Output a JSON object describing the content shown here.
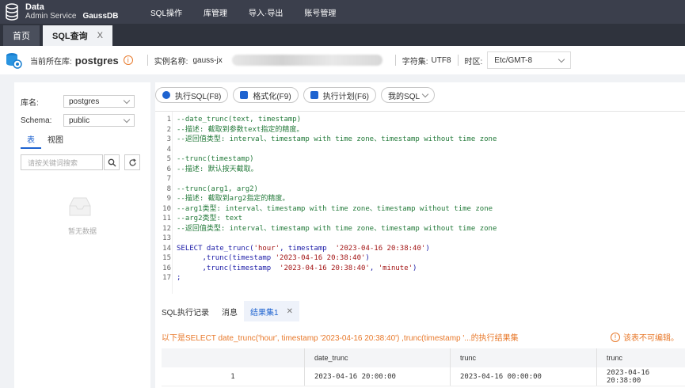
{
  "app": {
    "logo_line1": "Data",
    "logo_line2": "Admin Service",
    "product": "GaussDB",
    "nav": [
      "SQL操作",
      "库管理",
      "导入·导出",
      "账号管理"
    ]
  },
  "tabs": {
    "home": "首页",
    "active": "SQL查询",
    "close": "X"
  },
  "info": {
    "current_db_label": "当前所在库:",
    "current_db": "postgres",
    "instance_label": "实例名称:",
    "instance": "gauss-jx",
    "charset_label": "字符集:",
    "charset": "UTF8",
    "timezone_label": "时区:",
    "timezone": "Etc/GMT-8"
  },
  "left": {
    "db_label": "库名:",
    "db_value": "postgres",
    "schema_label": "Schema:",
    "schema_value": "public",
    "tab_table": "表",
    "tab_view": "视图",
    "search_placeholder": "请按关键词搜索",
    "empty_text": "暂无数据"
  },
  "toolbar": {
    "execute": "执行SQL(F8)",
    "format": "格式化(F9)",
    "plan": "执行计划(F6)",
    "my_sql": "我的SQL"
  },
  "editor": {
    "lines": [
      {
        "n": "1",
        "parts": [
          {
            "t": "--date_trunc(text, timestamp)",
            "c": "comment"
          }
        ]
      },
      {
        "n": "2",
        "parts": [
          {
            "t": "--描述: 截取到参数text指定的精度。",
            "c": "comment"
          }
        ]
      },
      {
        "n": "3",
        "parts": [
          {
            "t": "--返回值类型: interval、timestamp with time zone、timestamp without time zone",
            "c": "comment"
          }
        ]
      },
      {
        "n": "4",
        "parts": []
      },
      {
        "n": "5",
        "parts": [
          {
            "t": "--trunc(timestamp)",
            "c": "comment"
          }
        ]
      },
      {
        "n": "6",
        "parts": [
          {
            "t": "--描述: 默认按天截取。",
            "c": "comment"
          }
        ]
      },
      {
        "n": "7",
        "parts": []
      },
      {
        "n": "8",
        "parts": [
          {
            "t": "--trunc(arg1, arg2)",
            "c": "comment"
          }
        ]
      },
      {
        "n": "9",
        "parts": [
          {
            "t": "--描述: 截取到arg2指定的精度。",
            "c": "comment"
          }
        ]
      },
      {
        "n": "10",
        "parts": [
          {
            "t": "--arg1类型: interval、timestamp with time zone、timestamp without time zone",
            "c": "comment"
          }
        ]
      },
      {
        "n": "11",
        "parts": [
          {
            "t": "--arg2类型: text",
            "c": "comment"
          }
        ]
      },
      {
        "n": "12",
        "parts": [
          {
            "t": "--返回值类型: interval、timestamp with time zone、timestamp without time zone",
            "c": "comment"
          }
        ]
      },
      {
        "n": "13",
        "parts": []
      },
      {
        "n": "14",
        "parts": [
          {
            "t": "SELECT",
            "c": "kw"
          },
          {
            "t": " date_trunc(",
            "c": "plain"
          },
          {
            "t": "'hour'",
            "c": "str"
          },
          {
            "t": ", timestamp  ",
            "c": "plain"
          },
          {
            "t": "'2023-04-16 20:38:40'",
            "c": "str"
          },
          {
            "t": ")",
            "c": "plain"
          }
        ]
      },
      {
        "n": "15",
        "parts": [
          {
            "t": "      ,trunc(timestamp ",
            "c": "plain"
          },
          {
            "t": "'2023-04-16 20:38:40'",
            "c": "str"
          },
          {
            "t": ")",
            "c": "plain"
          }
        ]
      },
      {
        "n": "16",
        "parts": [
          {
            "t": "      ,trunc(timestamp  ",
            "c": "plain"
          },
          {
            "t": "'2023-04-16 20:38:40'",
            "c": "str"
          },
          {
            "t": ", ",
            "c": "plain"
          },
          {
            "t": "'minute'",
            "c": "str"
          },
          {
            "t": ")",
            "c": "plain"
          }
        ]
      },
      {
        "n": "17",
        "parts": [
          {
            "t": ";",
            "c": "plain"
          }
        ]
      }
    ]
  },
  "results": {
    "tabs": [
      "SQL执行记录",
      "消息",
      "结果集1"
    ],
    "close": "✕",
    "note": "以下是SELECT date_trunc('hour', timestamp '2023-04-16 20:38:40') ,trunc(timestamp '...的执行结果集",
    "readonly": "该表不可编辑。",
    "headers": [
      "",
      "date_trunc",
      "trunc",
      "trunc"
    ],
    "rows": [
      [
        "1",
        "2023-04-16 20:00:00",
        "2023-04-16 00:00:00",
        "2023-04-16 20:38:00"
      ]
    ]
  }
}
